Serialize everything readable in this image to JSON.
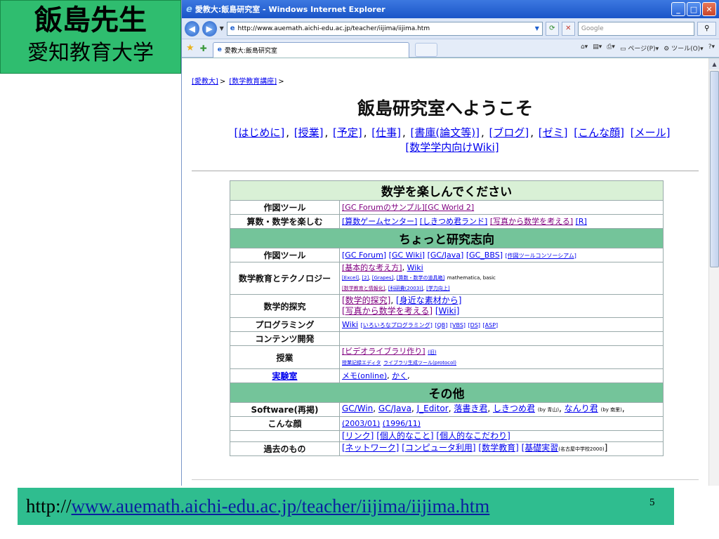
{
  "slide": {
    "title_line1": "飯島先生",
    "title_line2": "愛知教育大学",
    "caption_prefix": "http://",
    "caption_link": "www.auemath.aichi-edu.ac.jp/teacher/iijima/iijima.htm",
    "page_number": "5"
  },
  "browser": {
    "window_title": "愛教大:飯島研究室 - Windows Internet Explorer",
    "url": "http://www.auemath.aichi-edu.ac.jp/teacher/iijima/iijima.htm",
    "search_placeholder": "Google",
    "tab_title": "愛教大:飯島研究室",
    "cmd_page": "ページ(P)",
    "cmd_tools": "ツール(O)",
    "icons": {
      "back": "back-arrow-icon",
      "forward": "forward-arrow-icon",
      "refresh": "refresh-icon",
      "stop": "stop-icon",
      "search": "search-icon",
      "favorites": "star-icon",
      "home": "home-icon",
      "print": "print-icon",
      "help": "help-icon"
    }
  },
  "page": {
    "breadcrumb": [
      "[愛教大]",
      "[数学教育講座]"
    ],
    "heading": "飯島研究室へようこそ",
    "nav_links": [
      "[はじめに]",
      "[授業]",
      "[予定]",
      "[仕事]",
      "[書庫(論文等)]",
      "[ブログ]",
      "[ゼミ]",
      "[こんな顔]",
      "[メール]",
      "[数学学内向けWiki]"
    ],
    "sections": [
      {
        "title": "数学を楽しんでください",
        "rows": [
          {
            "label": "作図ツール",
            "links": [
              "[GC Forumのサンプル]",
              "[GC World 2]"
            ]
          },
          {
            "label": "算数・数学を楽しむ",
            "links": [
              "[算数ゲームセンター]",
              "[しきつめ君ランド]",
              "[写真から数学を考える]",
              "[R]"
            ]
          }
        ]
      },
      {
        "title": "ちょっと研究志向",
        "rows": [
          {
            "label": "作図ツール",
            "links": [
              "[GC Forum]",
              "[GC Wiki]",
              "[GC/Java]",
              "[GC_BBS]",
              "[作図ツールコンソーシアム]"
            ]
          },
          {
            "label": "数学教育とテクノロジー",
            "links": [
              "[基本的な考え方]",
              "Wiki",
              "[Excel]",
              "[2]",
              "[Grapes]",
              "[算数・数学の道具箱]",
              "mathematica, basic",
              "[数学教育と情報化]",
              "[科研費(2003)]",
              "[学力向上]"
            ]
          },
          {
            "label": "数学的探究",
            "links": [
              "[数学的探究]",
              "[身近な素材から]",
              "[写真から数学を考える]",
              "[Wiki]"
            ]
          },
          {
            "label": "プログラミング",
            "links": [
              "Wiki",
              "[いろいろなプログラミング]",
              "[QB]",
              "[VBS]",
              "[DS]",
              "[ASP]"
            ]
          },
          {
            "label": "コンテンツ開発",
            "links": []
          },
          {
            "label": "授業",
            "links": [
              "[ビデオライブラリ作り]",
              "(旧)",
              "授業記録エディタ",
              "ライブラリ生成ツール(protocol)"
            ]
          },
          {
            "label": "実験室",
            "links": [
              "メモ(online)",
              "かく"
            ]
          }
        ]
      },
      {
        "title": "その他",
        "rows": [
          {
            "label": "Software(再掲)",
            "links": [
              "GC/Win",
              "GC/Java",
              "J_Editor",
              "落書き君",
              "しきつめ君",
              "(by 青山)",
              "なんり君",
              "(by 南里)"
            ]
          },
          {
            "label": "こんな顔",
            "links": [
              "(2003/01)",
              "(1996/11)"
            ]
          },
          {
            "label": "",
            "links": [
              "[リンク]",
              "[個人的なこと]",
              "[個人的なこだわり]"
            ]
          },
          {
            "label": "過去のもの",
            "links": [
              "[ネットワーク]",
              "[コンピュータ利用]",
              "[数学教育]",
              "[基礎実習",
              "(名古屋中学校2000)",
              "]"
            ]
          }
        ]
      }
    ]
  }
}
